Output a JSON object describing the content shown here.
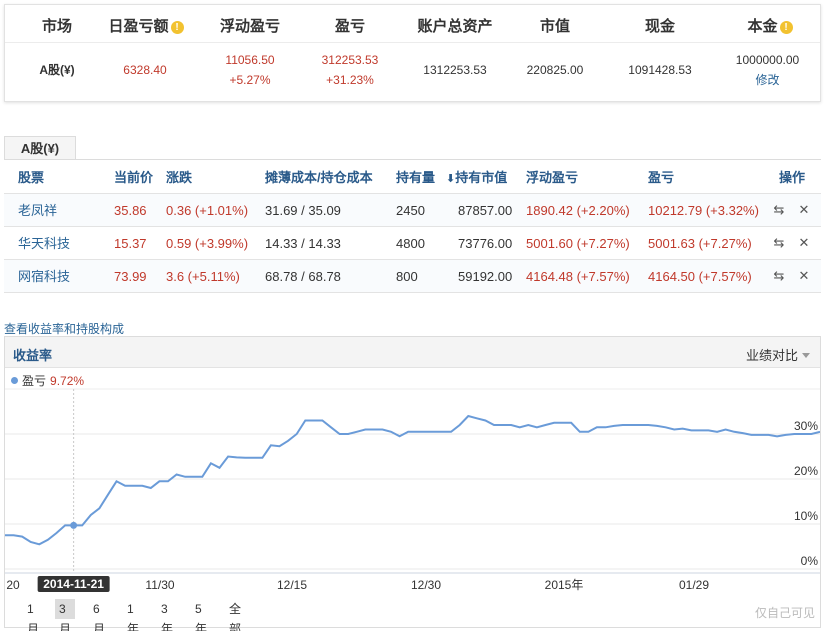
{
  "summary": {
    "headers": {
      "market": "市场",
      "daily_pl": "日盈亏额",
      "float_pl": "浮动盈亏",
      "pl": "盈亏",
      "total_assets": "账户总资产",
      "market_value": "市值",
      "cash": "现金",
      "principal": "本金"
    },
    "row": {
      "market": "A股(¥)",
      "daily_pl": "6328.40",
      "float_pl_amount": "11056.50",
      "float_pl_pct": "+5.27%",
      "pl_amount": "312253.53",
      "pl_pct": "+31.23%",
      "total_assets": "1312253.53",
      "market_value": "220825.00",
      "cash": "1091428.53",
      "principal": "1000000.00",
      "edit_label": "修改"
    }
  },
  "holdings": {
    "tab_label": "A股(¥)",
    "columns": {
      "stock": "股票",
      "price": "当前价",
      "change": "涨跌",
      "cost": "摊薄成本/持仓成本",
      "shares": "持有量",
      "holding_value": "持有市值",
      "float_pl": "浮动盈亏",
      "pl": "盈亏",
      "actions": "操作"
    },
    "rows": [
      {
        "name": "老凤祥",
        "price": "35.86",
        "change": "0.36 (+1.01%)",
        "cost": "31.69 / 35.09",
        "shares": "2450",
        "value": "87857.00",
        "float_pl": "1890.42 (+2.20%)",
        "pl": "10212.79 (+3.32%)"
      },
      {
        "name": "华天科技",
        "price": "15.37",
        "change": "0.59 (+3.99%)",
        "cost": "14.33 / 14.33",
        "shares": "4800",
        "value": "73776.00",
        "float_pl": "5001.60 (+7.27%)",
        "pl": "5001.63 (+7.27%)"
      },
      {
        "name": "网宿科技",
        "price": "73.99",
        "change": "3.6 (+5.11%)",
        "cost": "68.78 / 68.78",
        "shares": "800",
        "value": "59192.00",
        "float_pl": "4164.48 (+7.57%)",
        "pl": "4164.50 (+7.57%)"
      }
    ]
  },
  "chart_section": {
    "link": "查看收益率和持股构成",
    "title": "收益率",
    "compare_label": "业绩对比",
    "legend_name": "盈亏",
    "legend_value": "9.72%",
    "ranges": [
      "1月",
      "3月",
      "6月",
      "1年",
      "3年",
      "5年",
      "全部"
    ],
    "active_range": "3月",
    "watermark": "仅自己可见"
  },
  "chart_data": {
    "type": "line",
    "x_labels": [
      "20",
      "11/30",
      "12/15",
      "12/30",
      "2015年",
      "01/29"
    ],
    "hover_label": "2014-11-21",
    "hover_index": 8,
    "y_ticks": [
      "0%",
      "10%",
      "20%",
      "30%"
    ],
    "ylim": [
      0,
      40
    ],
    "series": [
      {
        "name": "盈亏",
        "color": "#6a9bd8",
        "values": [
          7.5,
          7.5,
          7.2,
          6.0,
          5.5,
          6.5,
          8.0,
          9.7,
          9.7,
          9.7,
          12.0,
          13.5,
          16.5,
          19.5,
          18.5,
          18.5,
          18.5,
          18.0,
          19.5,
          19.5,
          21.0,
          20.5,
          20.5,
          20.5,
          23.5,
          22.5,
          25.0,
          24.8,
          24.7,
          24.7,
          24.7,
          27.5,
          27.3,
          28.5,
          30.0,
          33.0,
          33.0,
          33.0,
          31.5,
          30.0,
          30.0,
          30.5,
          31.0,
          31.0,
          31.0,
          30.5,
          29.5,
          30.5,
          30.5,
          30.5,
          30.5,
          30.5,
          30.5,
          32.0,
          34.0,
          33.5,
          33.0,
          32.0,
          32.0,
          32.0,
          31.5,
          32.0,
          31.5,
          32.0,
          32.5,
          32.5,
          32.5,
          30.5,
          30.5,
          31.5,
          31.5,
          31.8,
          32.0,
          32.0,
          32.0,
          32.0,
          31.8,
          31.5,
          31.0,
          31.2,
          30.8,
          30.8,
          30.8,
          30.5,
          31.0,
          30.5,
          30.2,
          29.8,
          29.8,
          29.8,
          29.5,
          29.8,
          30.0,
          30.0,
          30.0,
          30.5
        ]
      }
    ]
  }
}
